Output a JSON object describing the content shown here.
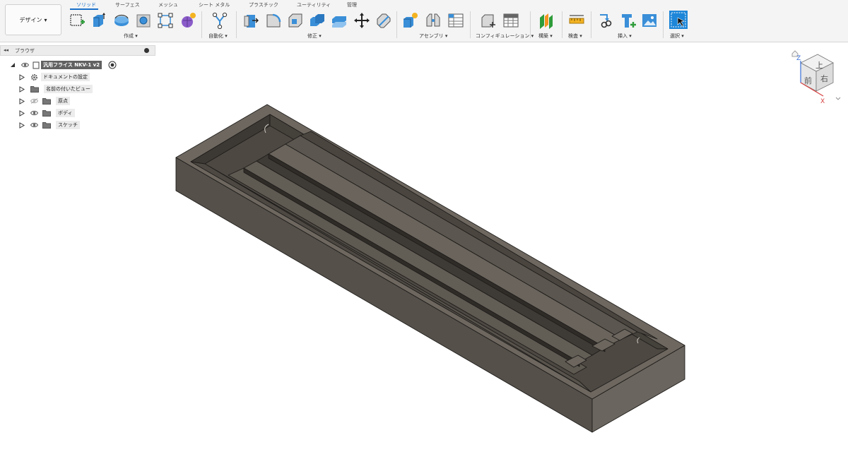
{
  "workspace": {
    "label": "デザイン",
    "arrow": "▾"
  },
  "tabs": [
    "ソリッド",
    "サーフェス",
    "メッシュ",
    "シート メタル",
    "プラスチック",
    "ユーティリティ",
    "管理"
  ],
  "groups": {
    "create": "作成 ▾",
    "automate": "自動化 ▾",
    "modify": "修正 ▾",
    "assemble": "アセンブリ ▾",
    "configure": "コンフィギュレーション ▾",
    "construct": "構築 ▾",
    "inspect": "検査 ▾",
    "insert": "挿入 ▾",
    "select": "選択 ▾"
  },
  "icons": {
    "create": [
      "sketch-icon",
      "extrude-icon",
      "revolve-icon",
      "hole-icon",
      "rectangle-pattern-icon",
      "form-icon"
    ],
    "automate": [
      "automate-icon"
    ],
    "modify": [
      "press-pull-icon",
      "fillet-icon",
      "shell-icon",
      "combine-icon",
      "offset-face-icon",
      "move-icon",
      "split-icon"
    ],
    "assemble": [
      "new-component-icon",
      "joint-icon",
      "table-icon"
    ],
    "configure": [
      "configure-icon",
      "configure-table-icon"
    ],
    "construct": [
      "plane-icon"
    ],
    "inspect": [
      "measure-icon"
    ],
    "insert": [
      "insert-derive-icon",
      "text-icon",
      "image-icon"
    ],
    "select": [
      "select-icon"
    ]
  },
  "browser": {
    "title": "ブラウザ",
    "collapse": "◂◂",
    "root": "汎用フライス NKV-1 v2",
    "items": [
      {
        "label": "ドキュメントの設定",
        "icon": "gear-icon",
        "eye": false,
        "eye_hidden": false
      },
      {
        "label": "名前の付いたビュー",
        "icon": "folder-icon",
        "eye": false,
        "eye_hidden": false
      },
      {
        "label": "原点",
        "icon": "folder-icon",
        "eye": true,
        "eye_hidden": true
      },
      {
        "label": "ボディ",
        "icon": "folder-icon",
        "eye": true,
        "eye_hidden": false
      },
      {
        "label": "スケッチ",
        "icon": "folder-icon",
        "eye": true,
        "eye_hidden": false
      }
    ]
  },
  "viewcube": {
    "top": "上",
    "front": "前",
    "right": "右",
    "axis_z": "Z",
    "axis_x": "X"
  },
  "colors": {
    "accent": "#1a6fc9",
    "model_dark": "#3f3b36",
    "model_mid": "#5a554e",
    "model_light": "#77716a",
    "model_edge": "#1e1c1a"
  }
}
